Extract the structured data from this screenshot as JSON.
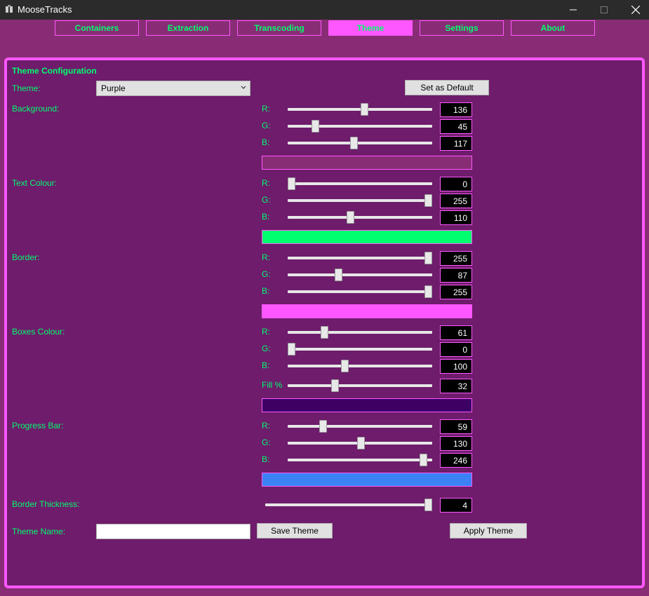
{
  "window": {
    "title": "MooseTracks",
    "controls": [
      "minimize",
      "maximize",
      "close"
    ]
  },
  "tabs": [
    {
      "label": "Containers",
      "active": false
    },
    {
      "label": "Extraction",
      "active": false
    },
    {
      "label": "Transcoding",
      "active": false
    },
    {
      "label": "Theme",
      "active": true
    },
    {
      "label": "Settings",
      "active": false
    },
    {
      "label": "About",
      "active": false
    }
  ],
  "theme_config": {
    "section_title": "Theme Configuration",
    "theme_label": "Theme:",
    "theme_selected": "Purple",
    "set_default_label": "Set as Default",
    "channel_labels": {
      "r": "R:",
      "g": "G:",
      "b": "B:",
      "fill": "Fill %"
    },
    "background": {
      "label": "Background:",
      "r": 136,
      "g": 45,
      "b": 117,
      "preview_color": "#882d75"
    },
    "text_colour": {
      "label": "Text Colour:",
      "r": 0,
      "g": 255,
      "b": 110,
      "preview_color": "#00ff6e"
    },
    "border": {
      "label": "Border:",
      "r": 255,
      "g": 87,
      "b": 255,
      "preview_color": "#ff57ff"
    },
    "boxes_colour": {
      "label": "Boxes Colour:",
      "r": 61,
      "g": 0,
      "b": 100,
      "fill": 32,
      "preview_color": "#3d0064"
    },
    "progress_bar": {
      "label": "Progress Bar:",
      "r": 59,
      "g": 130,
      "b": 246,
      "preview_color": "#3b82f6"
    },
    "border_thickness": {
      "label": "Border Thickness:",
      "value": 4,
      "min": 0,
      "max": 4
    },
    "theme_name_label": "Theme Name:",
    "theme_name_value": "",
    "save_theme_label": "Save Theme",
    "apply_theme_label": "Apply Theme"
  },
  "colors": {
    "accent": "#ff57ff",
    "text": "#00ff6e",
    "window_bg": "#882d75",
    "panel_bg": "#6e1c6b"
  }
}
